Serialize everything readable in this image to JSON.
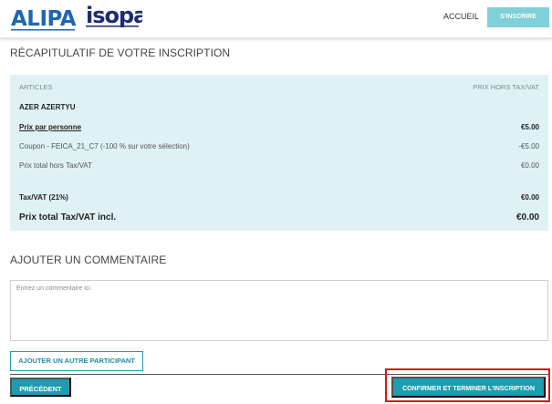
{
  "header": {
    "logo_alipa": "ALIPA",
    "logo_isopa": "isopa",
    "nav_home": "ACCUEIL",
    "register_button": "S'INSCRIRE"
  },
  "summary": {
    "title": "RÉCAPITULATIF DE VOTRE INSCRIPTION",
    "col_articles": "ARTICLES",
    "col_price": "PRIX HORS TAX/VAT",
    "participant_name": "AZER AZERTYU",
    "rows": [
      {
        "label": "Prix par personne",
        "value": "€5.00"
      },
      {
        "label": "Coupon - FEICA_21_C7 (-100 % sur votre sélection)",
        "value": "-€5.00"
      },
      {
        "label": "Prix total hors Tax/VAT",
        "value": "€0.00"
      },
      {
        "label": "Tax/VAT (21%)",
        "value": "€0.00"
      },
      {
        "label": "Prix total Tax/VAT incl.",
        "value": "€0.00"
      }
    ]
  },
  "comment": {
    "title": "AJOUTER UN COMMENTAIRE",
    "placeholder": "Entrez un commentaire ici"
  },
  "actions": {
    "add_participant": "AJOUTER UN AUTRE PARTICIPANT",
    "previous": "PRÉCÉDENT",
    "confirm": "CONFIRMER ET TERMINER L'INSCRIPTION"
  },
  "colors": {
    "accent": "#1e9db0",
    "summary_bg": "#dff1f4",
    "highlight": "#d11a1a"
  }
}
